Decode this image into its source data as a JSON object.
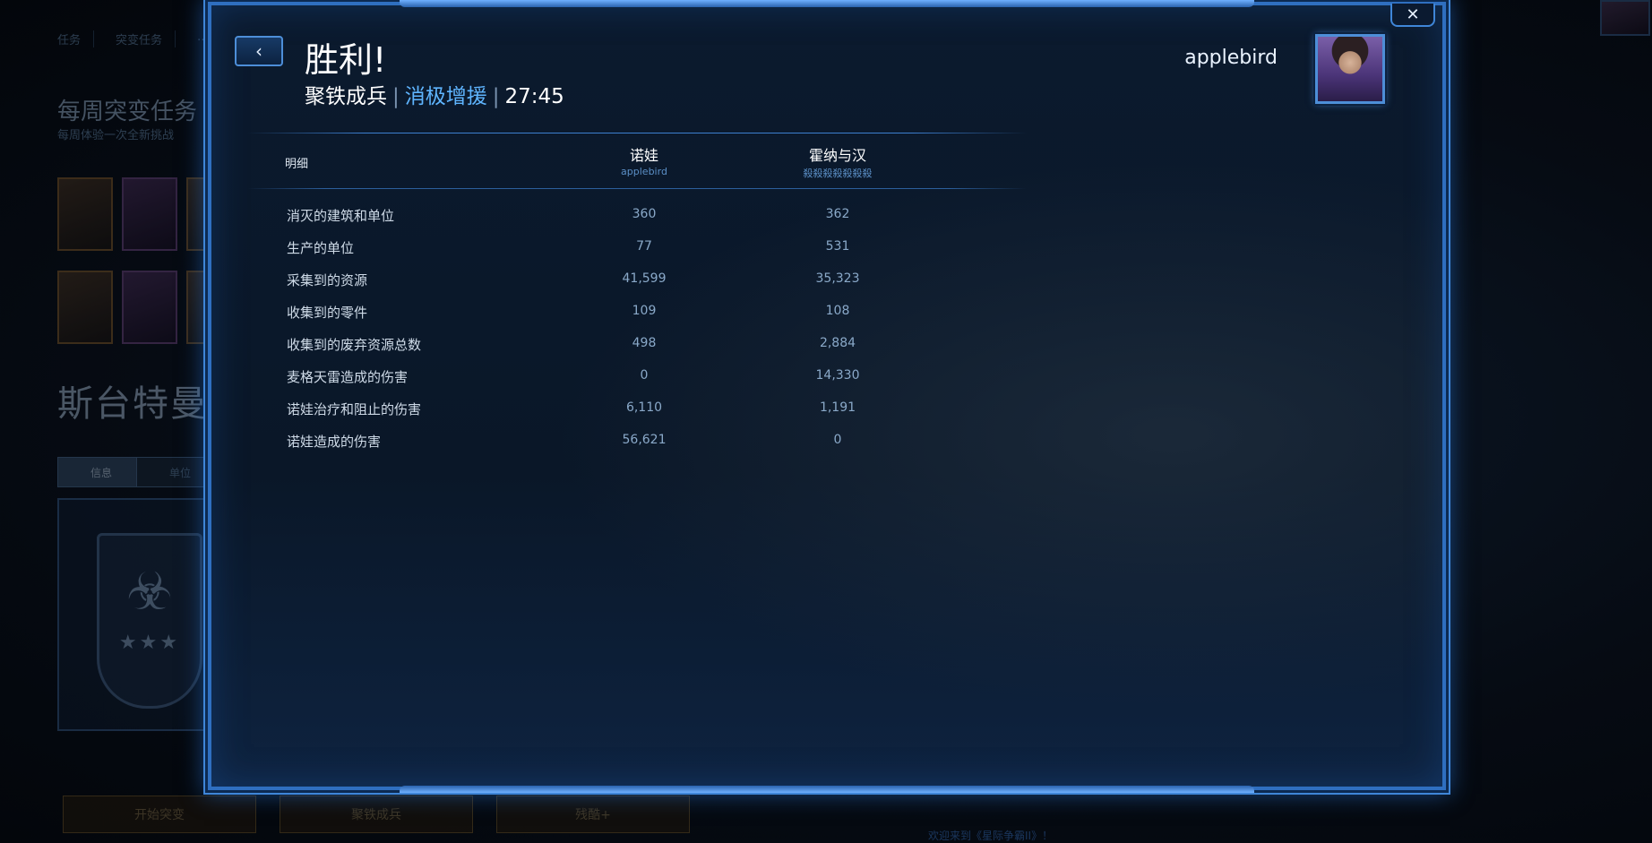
{
  "background": {
    "tabs": [
      "任务",
      "突变任务",
      "…"
    ],
    "heading": "每周突变任务",
    "subheading": "每周体验一次全新挑战",
    "map_title": "斯台特曼",
    "info_tabs": [
      "信息",
      "单位"
    ],
    "bottom_buttons": [
      "开始突变",
      "聚铁成兵",
      "残酷+"
    ],
    "footer_link": "欢迎来到《星际争霸II》！"
  },
  "dialog": {
    "title": "胜利!",
    "mission": "聚铁成兵",
    "difficulty": "消极增援",
    "time": "27:45",
    "separator": "|",
    "player_name": "applebird",
    "back_icon": "chevron-left-icon",
    "close_icon": "close-icon",
    "close_glyph": "✕",
    "back_glyph": "‹"
  },
  "table": {
    "detail_header": "明细",
    "players": [
      {
        "commander": "诺娃",
        "name": "applebird"
      },
      {
        "commander": "霍纳与汉",
        "name": "殺殺殺殺殺殺殺"
      }
    ],
    "rows": [
      {
        "label": "消灭的建筑和单位",
        "p1": "360",
        "p2": "362"
      },
      {
        "label": "生产的单位",
        "p1": "77",
        "p2": "531"
      },
      {
        "label": "采集到的资源",
        "p1": "41,599",
        "p2": "35,323"
      },
      {
        "label": "收集到的零件",
        "p1": "109",
        "p2": "108"
      },
      {
        "label": "收集到的废弃资源总数",
        "p1": "498",
        "p2": "2,884"
      },
      {
        "label": "麦格天雷造成的伤害",
        "p1": "0",
        "p2": "14,330"
      },
      {
        "label": "诺娃治疗和阻止的伤害",
        "p1": "6,110",
        "p2": "1,191"
      },
      {
        "label": "诺娃造成的伤害",
        "p1": "56,621",
        "p2": "0"
      }
    ]
  },
  "colors": {
    "accent": "#3f86d8",
    "difficulty": "#5fb5ff",
    "value": "#8aa9c9"
  }
}
